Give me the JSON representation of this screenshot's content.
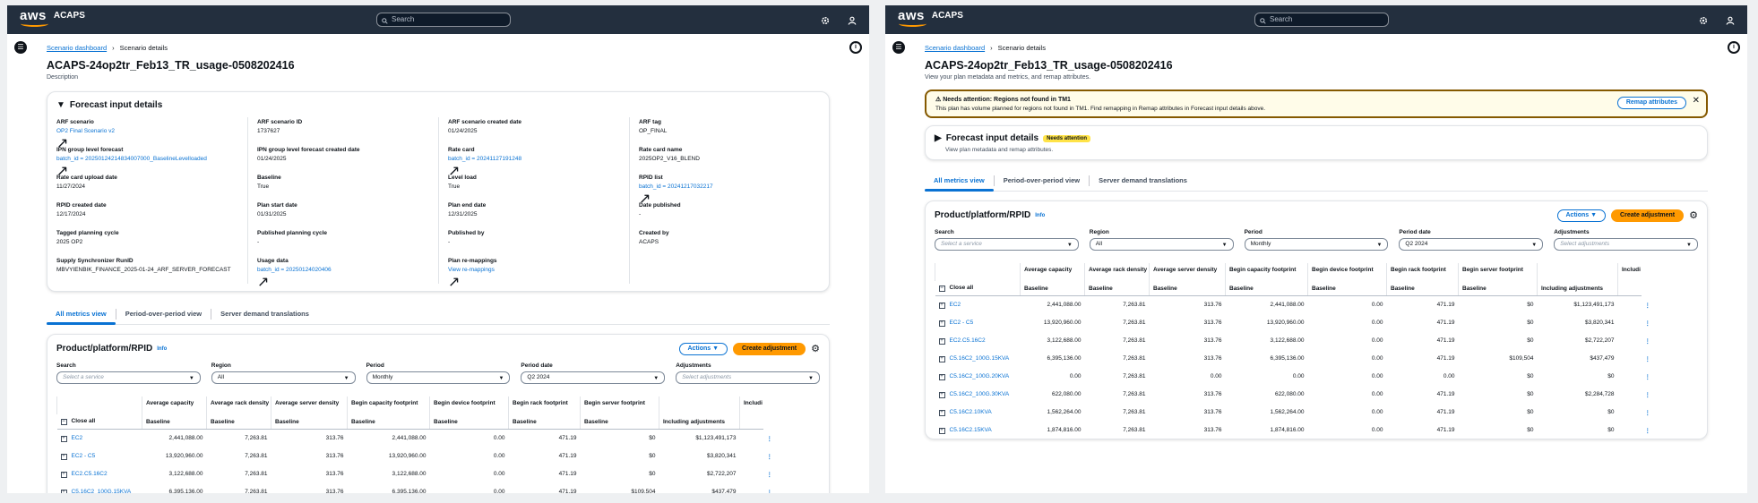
{
  "header": {
    "brand": "aws",
    "app_name": "ACAPS",
    "search_placeholder": "Search"
  },
  "breadcrumb": {
    "root": "Scenario dashboard",
    "current": "Scenario details"
  },
  "page": {
    "title": "ACAPS-24op2tr_Feb13_TR_usage-0508202416",
    "description_left": "Description",
    "description_right": "View your plan metadata and metrics, and remap attributes."
  },
  "alert": {
    "title": "Needs attention: Regions not found in TM1",
    "body": "This plan has volume planned for regions not found in TM1. Find remapping in Remap attributes in Forecast input details above.",
    "button": "Remap attributes"
  },
  "forecast": {
    "title": "Forecast input details",
    "badge": "Needs attention",
    "subtitle": "View plan metadata and remap attributes.",
    "columns": [
      [
        {
          "k": "ARF scenario",
          "v": "OP2 Final Scenario v2",
          "link": true
        },
        {
          "k": "IPN group level forecast",
          "v": "batch_id = 20250124214834007000_BaselineLevelloaded",
          "link": true
        },
        {
          "k": "Rate card upload date",
          "v": "11/27/2024"
        },
        {
          "k": "RPID created date",
          "v": "12/17/2024"
        },
        {
          "k": "Tagged planning cycle",
          "v": "2025 OP2"
        },
        {
          "k": "Supply Synchronizer RunID",
          "v": "MBVYIENBIK_FINANCE_2025-01-24_ARF_SERVER_FORECAST"
        }
      ],
      [
        {
          "k": "ARF scenario ID",
          "v": "1737627"
        },
        {
          "k": "IPN group level forecast created date",
          "v": "01/24/2025"
        },
        {
          "k": "Baseline",
          "v": "True"
        },
        {
          "k": "Plan start date",
          "v": "01/31/2025"
        },
        {
          "k": "Published planning cycle",
          "v": "-"
        },
        {
          "k": "Usage data",
          "v": "batch_id = 20250124020406",
          "link": true
        }
      ],
      [
        {
          "k": "ARF scenario created date",
          "v": "01/24/2025"
        },
        {
          "k": "Rate card",
          "v": "batch_id = 20241127191248",
          "link": true
        },
        {
          "k": "Level load",
          "v": "True"
        },
        {
          "k": "Plan end date",
          "v": "12/31/2025"
        },
        {
          "k": "Published by",
          "v": "-"
        },
        {
          "k": "Plan re-mappings",
          "v": "View re-mappings",
          "link": true
        }
      ],
      [
        {
          "k": "ARF tag",
          "v": "OP_FINAL"
        },
        {
          "k": "Rate card name",
          "v": "2025OP2_V16_BLEND"
        },
        {
          "k": "RPID list",
          "v": "batch_id = 20241217032217",
          "link": true
        },
        {
          "k": "Date published",
          "v": "-"
        },
        {
          "k": "Created by",
          "v": "ACAPS"
        }
      ]
    ]
  },
  "tabs": [
    "All metrics view",
    "Period-over-period view",
    "Server demand translations"
  ],
  "product": {
    "title": "Product/platform/RPID",
    "info": "Info",
    "actions": "Actions",
    "create": "Create adjustment",
    "filters": [
      {
        "label": "Search",
        "value": "Select a service",
        "placeholder": true
      },
      {
        "label": "Region",
        "value": "All",
        "placeholder": false
      },
      {
        "label": "Period",
        "value": "Monthly",
        "placeholder": false
      },
      {
        "label": "Period date",
        "value": "Q2 2024",
        "placeholder": false
      },
      {
        "label": "Adjustments",
        "value": "Select adjustments",
        "placeholder": true
      }
    ]
  },
  "table": {
    "close_all": "Close all",
    "group_headers": [
      "Average capacity",
      "Average rack density",
      "Average server density",
      "Begin capacity footprint",
      "Begin device footprint",
      "Begin rack footprint",
      "Begin server footprint",
      "",
      "Includi"
    ],
    "sub_header": "Baseline",
    "including_adjustments": "Including adjustments",
    "rows": [
      {
        "name": "EC2",
        "cells": [
          "2,441,088.00",
          "7,263.81",
          "313.76",
          "2,441,088.00",
          "0.00",
          "471.19",
          "$0",
          "$1,123,491,173"
        ]
      },
      {
        "name": "EC2 - C5",
        "cells": [
          "13,920,960.00",
          "7,263.81",
          "313.76",
          "13,920,960.00",
          "0.00",
          "471.19",
          "$0",
          "$3,820,341"
        ]
      },
      {
        "name": "EC2.C5.16C2",
        "cells": [
          "3,122,688.00",
          "7,263.81",
          "313.76",
          "3,122,688.00",
          "0.00",
          "471.19",
          "$0",
          "$2,722,207"
        ]
      },
      {
        "name": "C5.16C2_100G.15KVA",
        "cells": [
          "6,395,136.00",
          "7,263.81",
          "313.76",
          "6,395,136.00",
          "0.00",
          "471.19",
          "$109,504",
          "$437,479"
        ]
      },
      {
        "name": "C5.16C2_100G.20KVA",
        "cells": [
          "0.00",
          "7,263.81",
          "0.00",
          "0.00",
          "0.00",
          "0.00",
          "$0",
          "$0"
        ]
      },
      {
        "name": "C5.16C2_100G.30KVA",
        "cells": [
          "622,080.00",
          "7,263.81",
          "313.76",
          "622,080.00",
          "0.00",
          "471.19",
          "$0",
          "$2,284,728"
        ]
      },
      {
        "name": "C5.16C2.10KVA",
        "cells": [
          "1,562,264.00",
          "7,263.81",
          "313.76",
          "1,562,264.00",
          "0.00",
          "471.19",
          "$0",
          "$0"
        ]
      },
      {
        "name": "C5.16C2.15KVA",
        "cells": [
          "1,874,816.00",
          "7,263.81",
          "313.76",
          "1,874,816.00",
          "0.00",
          "471.19",
          "$0",
          "$0"
        ]
      }
    ]
  }
}
